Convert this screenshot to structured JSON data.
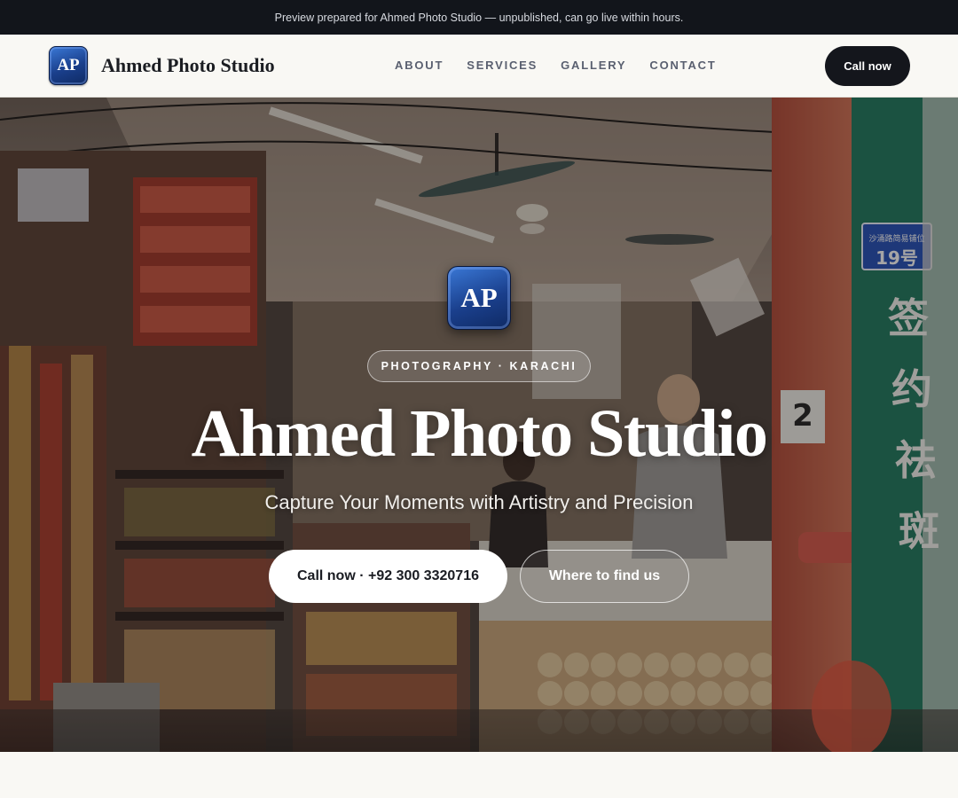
{
  "announcement": "Preview prepared for Ahmed Photo Studio — unpublished, can go live within hours.",
  "header": {
    "logo_initials": "AP",
    "brand_name": "Ahmed Photo Studio",
    "nav": [
      "ABOUT",
      "SERVICES",
      "GALLERY",
      "CONTACT"
    ],
    "cta_label": "Call now"
  },
  "hero": {
    "logo_initials": "AP",
    "badge": "PHOTOGRAPHY · KARACHI",
    "title": "Ahmed Photo Studio",
    "tagline": "Capture Your Moments with Artistry and Precision",
    "primary_button": "Call now · +92 300 3320716",
    "secondary_button": "Where to find us",
    "background_image": "market-shop-interior",
    "signs": {
      "blue_sign_line1": "沙涌路简易铺位",
      "blue_sign_line2": "19号",
      "vertical_sign": [
        "签",
        "约",
        "祛",
        "斑"
      ],
      "number_sign": "2"
    }
  },
  "colors": {
    "announcement_bg": "#12151b",
    "page_bg": "#f9f8f4",
    "cta_bg": "#14161c",
    "logo_blue": "#1a3f8c"
  }
}
